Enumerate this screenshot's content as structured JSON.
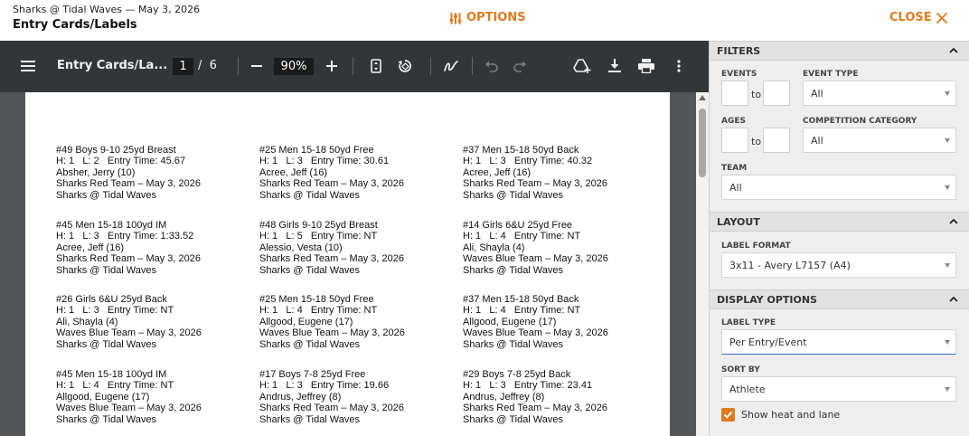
{
  "header": {
    "meet": "Sharks @ Tidal Waves — May 3, 2026",
    "title": "Entry Cards/Labels",
    "options_label": "OPTIONS",
    "close_label": "CLOSE",
    "accent_color": "#e07a1f"
  },
  "viewer": {
    "doc_name": "Entry Cards/La...",
    "page_current": "1",
    "page_separator": "/",
    "page_total": "6",
    "zoom": "90%",
    "icons": [
      "menu-icon",
      "zoom-out-icon",
      "zoom-in-icon",
      "fit-page-icon",
      "rotate-icon",
      "annotate-icon",
      "undo-icon",
      "redo-icon",
      "add-drive-icon",
      "download-icon",
      "print-icon",
      "more-icon"
    ]
  },
  "labels": [
    [
      "#49 Boys 9-10 25yd Breast",
      "H: 1   L: 2   Entry Time: 45.67",
      "Absher, Jerry (10)",
      "Sharks Red Team – May 3, 2026",
      "Sharks @ Tidal Waves"
    ],
    [
      "#25 Men 15-18 50yd Free",
      "H: 1   L: 3   Entry Time: 30.61",
      "Acree, Jeff (16)",
      "Sharks Red Team – May 3, 2026",
      "Sharks @ Tidal Waves"
    ],
    [
      "#37 Men 15-18 50yd Back",
      "H: 1   L: 3   Entry Time: 40.32",
      "Acree, Jeff (16)",
      "Sharks Red Team – May 3, 2026",
      "Sharks @ Tidal Waves"
    ],
    [
      "#45 Men 15-18 100yd IM",
      "H: 1   L: 3   Entry Time: 1:33.52",
      "Acree, Jeff (16)",
      "Sharks Red Team – May 3, 2026",
      "Sharks @ Tidal Waves"
    ],
    [
      "#48 Girls 9-10 25yd Breast",
      "H: 1   L: 5   Entry Time: NT",
      "Alessio, Vesta (10)",
      "Sharks Red Team – May 3, 2026",
      "Sharks @ Tidal Waves"
    ],
    [
      "#14 Girls 6&U 25yd Free",
      "H: 1   L: 4   Entry Time: NT",
      "Ali, Shayla (4)",
      "Waves Blue Team – May 3, 2026",
      "Sharks @ Tidal Waves"
    ],
    [
      "#26 Girls 6&U 25yd Back",
      "H: 1   L: 3   Entry Time: NT",
      "Ali, Shayla (4)",
      "Waves Blue Team – May 3, 2026",
      "Sharks @ Tidal Waves"
    ],
    [
      "#25 Men 15-18 50yd Free",
      "H: 1   L: 4   Entry Time: NT",
      "Allgood, Eugene (17)",
      "Waves Blue Team – May 3, 2026",
      "Sharks @ Tidal Waves"
    ],
    [
      "#37 Men 15-18 50yd Back",
      "H: 1   L: 4   Entry Time: NT",
      "Allgood, Eugene (17)",
      "Waves Blue Team – May 3, 2026",
      "Sharks @ Tidal Waves"
    ],
    [
      "#45 Men 15-18 100yd IM",
      "H: 1   L: 4   Entry Time: NT",
      "Allgood, Eugene (17)",
      "Waves Blue Team – May 3, 2026",
      "Sharks @ Tidal Waves"
    ],
    [
      "#17 Boys 7-8 25yd Free",
      "H: 1   L: 3   Entry Time: 19.66",
      "Andrus, Jeffrey (8)",
      "Sharks Red Team – May 3, 2026",
      "Sharks @ Tidal Waves"
    ],
    [
      "#29 Boys 7-8 25yd Back",
      "H: 1   L: 3   Entry Time: 23.41",
      "Andrus, Jeffrey (8)",
      "Sharks Red Team – May 3, 2026",
      "Sharks @ Tidal Waves"
    ]
  ],
  "panel": {
    "filters": {
      "title": "FILTERS",
      "events_label": "EVENTS",
      "to_label": "to",
      "event_type_label": "EVENT TYPE",
      "event_type_value": "All",
      "ages_label": "AGES",
      "competition_label": "COMPETITION CATEGORY",
      "competition_value": "All",
      "team_label": "TEAM",
      "team_value": "All"
    },
    "layout": {
      "title": "LAYOUT",
      "label_format_label": "LABEL FORMAT",
      "label_format_value": "3x11 - Avery L7157 (A4)"
    },
    "display": {
      "title": "DISPLAY OPTIONS",
      "label_type_label": "LABEL TYPE",
      "label_type_value": "Per Entry/Event",
      "sort_by_label": "SORT BY",
      "sort_by_value": "Athlete",
      "show_heat_lane_label": "Show heat and lane",
      "show_heat_lane_checked": true
    }
  }
}
